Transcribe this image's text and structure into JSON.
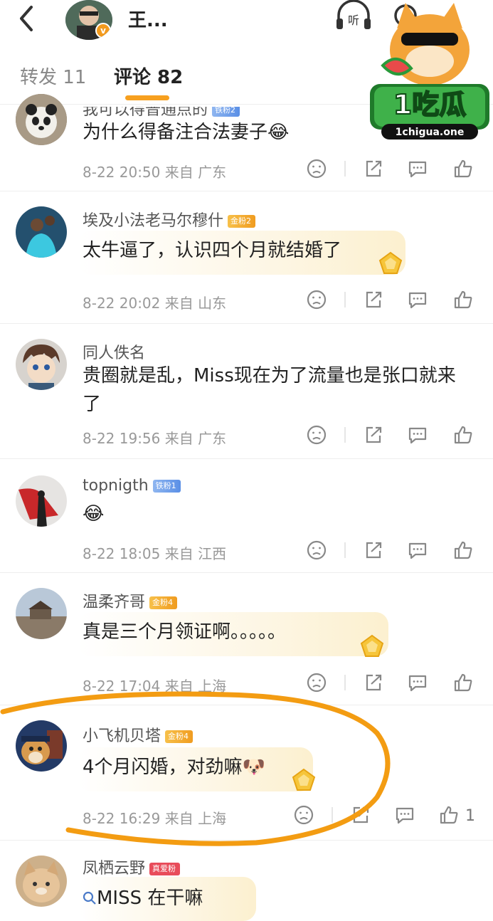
{
  "header": {
    "back_icon": "chevron-left-icon",
    "user_name": "王...",
    "verified_badge": "v",
    "listen_label": "听"
  },
  "tabs": {
    "repost_label": "转发 11",
    "comment_label": "评论 82"
  },
  "watermark": {
    "brand": "1吃瓜",
    "url": "1chigua.one"
  },
  "comments": [
    {
      "name": "我可以得普通点的",
      "badge": "铁粉2",
      "badge_type": "iron",
      "text": "为什么得备注合法妻子😂",
      "meta": "8-22 20:50  来自 广东",
      "likes": ""
    },
    {
      "name": "埃及小法老马尔穆什",
      "badge": "金粉2",
      "badge_type": "gold",
      "text": "太牛逼了，认识四个月就结婚了",
      "meta": "8-22 20:02  来自 山东",
      "likes": ""
    },
    {
      "name": "同人佚名",
      "badge": "",
      "badge_type": "",
      "text": "贵圈就是乱，Miss现在为了流量也是张口就来了",
      "meta": "8-22 19:56  来自 广东",
      "likes": ""
    },
    {
      "name": "topnigth",
      "badge": "铁粉1",
      "badge_type": "iron",
      "text": "😂",
      "meta": "8-22 18:05  来自 江西",
      "likes": ""
    },
    {
      "name": "温柔齐哥",
      "badge": "金粉4",
      "badge_type": "gold",
      "text": "真是三个月领证啊。。。。。",
      "meta": "8-22 17:04  来自 上海",
      "likes": ""
    },
    {
      "name": "小飞机贝塔",
      "badge": "金粉4",
      "badge_type": "gold",
      "text": "4个月闪婚，对劲嘛🐶",
      "meta": "8-22 16:29  来自 上海",
      "likes": "1"
    },
    {
      "name": "凤栖云野",
      "badge": "真爱粉",
      "badge_type": "true",
      "text": "MISS 在干嘛",
      "meta": "",
      "likes": ""
    }
  ],
  "colors": {
    "accent": "#f7a01f",
    "annotation_circle": "#f39c12"
  }
}
